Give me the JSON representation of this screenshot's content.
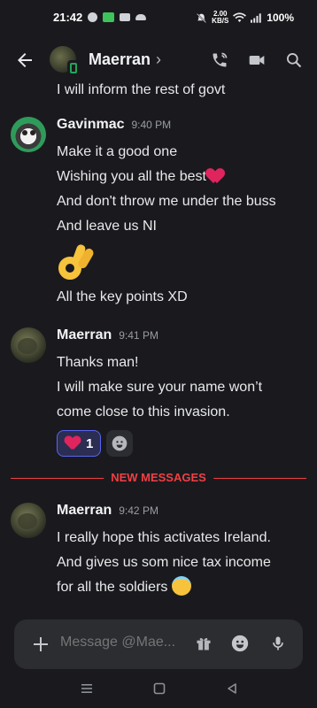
{
  "status_bar": {
    "time": "21:42",
    "net_speed_value": "2.00",
    "net_speed_unit": "KB/S",
    "battery": "100%"
  },
  "header": {
    "title": "Maerran",
    "chevron": "›"
  },
  "messages": {
    "partial_line": "I will inform the rest of govt",
    "group1": {
      "author": "Gavinmac",
      "time": "9:40 PM",
      "lines": [
        "Make it a good one",
        "Wishing you all the best",
        "And don't throw me under the buss",
        "And leave us NI"
      ],
      "after_emoji_line": "All the key points XD"
    },
    "group2": {
      "author": "Maerran",
      "time": "9:41 PM",
      "lines": [
        "Thanks man!",
        "I will make sure your name won’t",
        "come close to this invasion."
      ],
      "reaction_count": "1"
    },
    "divider_label": "NEW MESSAGES",
    "group3": {
      "author": "Maerran",
      "time": "9:42 PM",
      "lines": [
        "I really hope this activates Ireland.",
        "And gives us som nice tax income",
        "for all the soldiers"
      ]
    }
  },
  "composer": {
    "placeholder": "Message @Mae..."
  },
  "colors": {
    "background": "#1a1a1e",
    "composer_bg": "#2b2d31",
    "new_messages_red": "#f23f43",
    "reaction_border": "#5865f2",
    "online_green": "#23a55a"
  }
}
